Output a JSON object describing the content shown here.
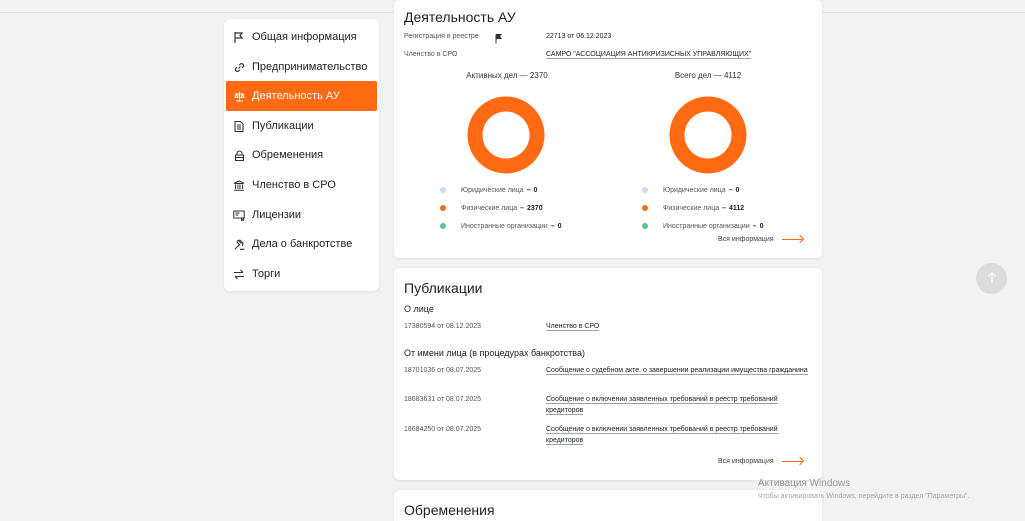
{
  "sidebar": {
    "items": [
      {
        "label": "Общая информация",
        "icon": "flag-icon"
      },
      {
        "label": "Предпринимательство",
        "icon": "link-icon"
      },
      {
        "label": "Деятельность АУ",
        "icon": "scales-icon",
        "active": true
      },
      {
        "label": "Публикации",
        "icon": "document-icon"
      },
      {
        "label": "Обременения",
        "icon": "lock-icon"
      },
      {
        "label": "Членство в СРО",
        "icon": "building-icon"
      },
      {
        "label": "Лицензии",
        "icon": "license-icon"
      },
      {
        "label": "Дела о банкротстве",
        "icon": "gavel-icon"
      },
      {
        "label": "Торги",
        "icon": "exchange-icon"
      }
    ]
  },
  "activity": {
    "title": "Деятельность АУ",
    "reg_label": "Регистрация в реестре",
    "reg_value": "22713 от 06.12.2023",
    "sro_label": "Членство в СРО",
    "sro_value": "САМРО \"АССОЦИАЦИЯ АНТИКРИЗИСНЫХ УПРАВЛЯЮЩИХ\"",
    "more_label": "Вся информация"
  },
  "chart_data": [
    {
      "type": "pie",
      "title": "Активных дел — 2370",
      "categories": [
        "Юридические лица",
        "Физические лица",
        "Иностранные организации"
      ],
      "values": [
        0,
        2370,
        0
      ],
      "value_labels": [
        "0",
        "2370",
        "0"
      ],
      "colors": [
        "#c7dcf5",
        "#ff6a13",
        "#5ec38a"
      ]
    },
    {
      "type": "pie",
      "title": "Всего дел — 4112",
      "categories": [
        "Юридические лица",
        "Физические лица",
        "Иностранные организации"
      ],
      "values": [
        0,
        4112,
        0
      ],
      "value_labels": [
        "0",
        "4112",
        "0"
      ],
      "colors": [
        "#c7dcf5",
        "#ff6a13",
        "#5ec38a"
      ]
    }
  ],
  "publications": {
    "title": "Публикации",
    "about_heading": "О лице",
    "about_rows": [
      {
        "id": "17380594 от 08.12.2023",
        "text": "Членство в СРО"
      }
    ],
    "behalf_heading": "От имени лица (в процедурах банкротства)",
    "behalf_rows": [
      {
        "id": "18701036 от 08.07.2025",
        "text": "Сообщение о судебном акте. о завершении реализации имущества гражданина"
      },
      {
        "id": "18683631 от 08.07.2025",
        "text": "Сообщение о включении заявленных требований в реестр требований кредиторов"
      },
      {
        "id": "18684250 от 08.07.2025",
        "text": "Сообщение о включении заявленных требований в реестр требований кредиторов"
      }
    ],
    "more_label": "Вся информация"
  },
  "encumbrances": {
    "title": "Обременения"
  },
  "watermark": {
    "line1": "Активация Windows",
    "line2": "Чтобы активировать Windows, перейдите в раздел \"Параметры\"."
  },
  "scroll_top_icon": "arrow-up-icon",
  "colors": {
    "accent": "#ff6a13",
    "legal": "#c7dcf5",
    "foreign": "#5ec38a"
  }
}
